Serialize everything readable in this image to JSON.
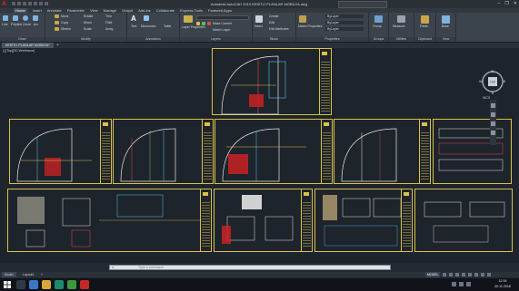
{
  "window": {
    "title": "Autodesk AutoCAD 2019  KESİTLİ PLANLAR MOBİLYA.dwg",
    "app_letter": "A",
    "controls": [
      "–",
      "❐",
      "✕"
    ]
  },
  "ribbon": {
    "tabs": [
      "Home",
      "Insert",
      "Annotate",
      "Parametric",
      "View",
      "Manage",
      "Output",
      "Add-ins",
      "Collaborate",
      "Express Tools",
      "Featured Apps"
    ],
    "active_tab": "Home",
    "panels": {
      "draw": "Draw",
      "modify": "Modify",
      "annotation": "Annotation",
      "layers": "Layers",
      "block": "Block",
      "properties": "Properties",
      "groups": "Groups",
      "utilities": "Utilities",
      "clipboard": "Clipboard",
      "view": "View"
    },
    "draw_buttons": [
      "Line",
      "Polyline",
      "Circle",
      "Arc"
    ],
    "modify_buttons": [
      "Move",
      "Rotate",
      "Trim",
      "Copy",
      "Mirror",
      "Fillet",
      "Stretch",
      "Scale",
      "Array"
    ],
    "annotation_buttons": [
      "Text",
      "Dimension",
      "Table"
    ],
    "layer_buttons": [
      "Layer Properties",
      "Make Current",
      "Match Layer"
    ],
    "block_buttons": [
      "Insert",
      "Create",
      "Edit",
      "Edit Attributes"
    ],
    "properties_buttons": [
      "Match Properties",
      "ByLayer",
      "ByLayer",
      "ByLayer"
    ],
    "groups_button": "Group",
    "utilities_button": "Measure",
    "clipboard_button": "Paste",
    "view_button": "Base"
  },
  "file_tab": {
    "label": "KESİTLİ PLANLAR MOBİLYA*",
    "plus": "+"
  },
  "viewport": {
    "label": "[-][Top][2D Wireframe]"
  },
  "viewcube": {
    "north": "N",
    "south": "S",
    "east": "E",
    "west": "W",
    "face": "TOP",
    "wcs": "WCS"
  },
  "command": {
    "placeholder": "Type a command",
    "close": "×"
  },
  "layout_tabs": [
    "Model",
    "Layout1",
    "+"
  ],
  "status": {
    "mode": "MODEL"
  },
  "taskbar": {
    "time": "12:34",
    "date": "20.11.2018"
  },
  "colors": {
    "sheet_border": "#d9c14a",
    "viewport_bg": "#1e242c",
    "ribbon_bg": "#3b434d",
    "accent_red": "#d22222"
  }
}
